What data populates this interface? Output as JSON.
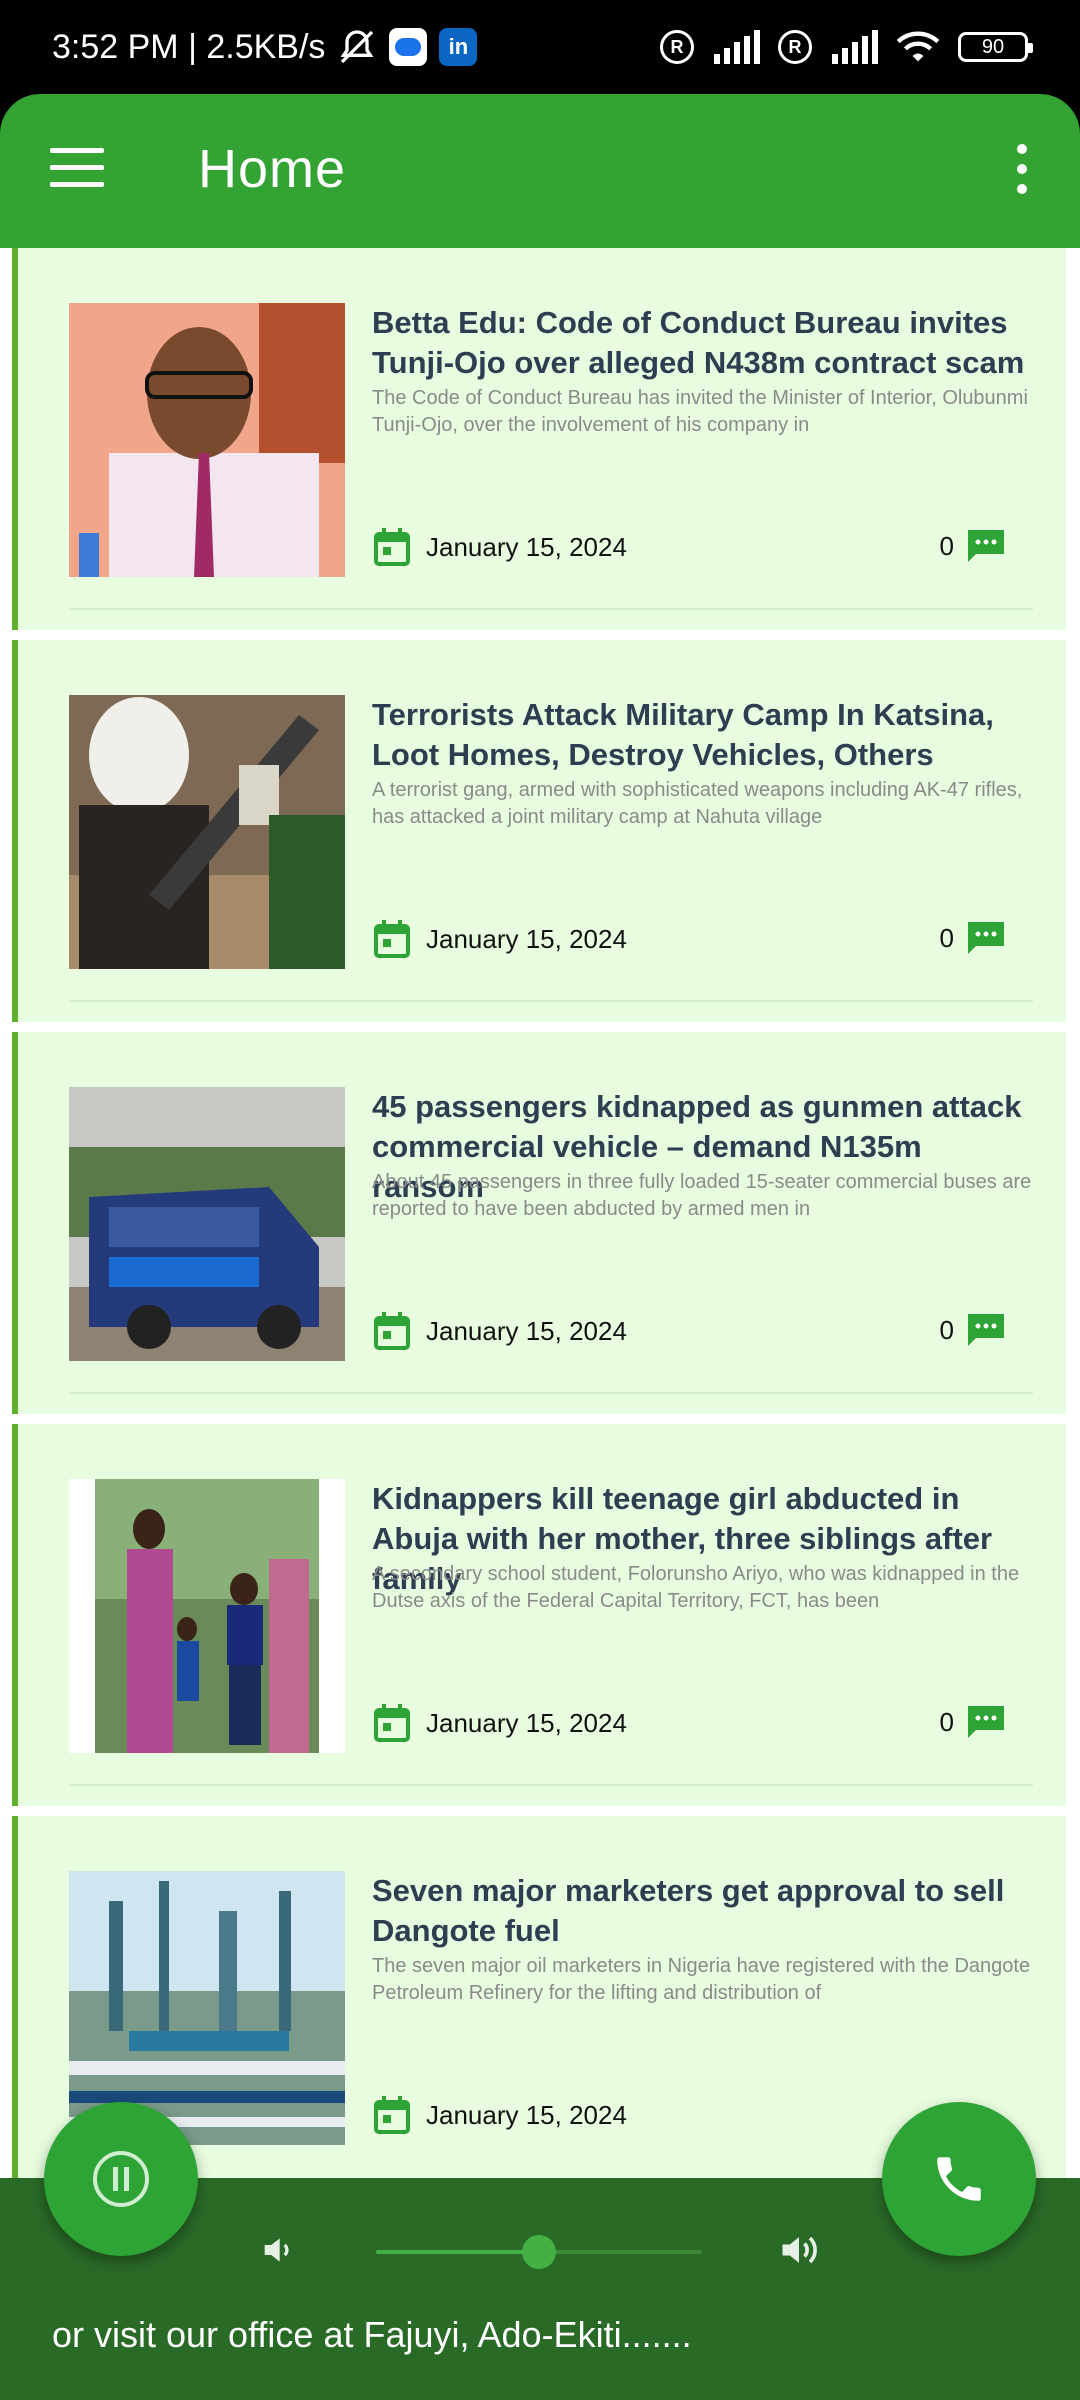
{
  "status_bar": {
    "time_speed": "3:52 PM | 2.5KB/s",
    "battery": "90"
  },
  "app_bar": {
    "title": "Home"
  },
  "articles": [
    {
      "title": "Betta Edu: Code of Conduct Bureau invites Tunji-Ojo over alleged N438m contract scam",
      "excerpt": "The Code of Conduct Bureau has invited the Minister of Interior, Olubunmi Tunji-Ojo, over the involvement of his company in",
      "date": "January 15, 2024",
      "comments": "0"
    },
    {
      "title": "Terrorists Attack Military Camp In Katsina, Loot Homes, Destroy Vehicles, Others",
      "excerpt": "A terrorist gang, armed with sophisticated weapons including AK-47 rifles, has attacked a joint military camp at Nahuta village",
      "date": "January 15, 2024",
      "comments": "0"
    },
    {
      "title": "45 passengers kidnapped as gunmen attack commercial vehicle – demand N135m ransom",
      "excerpt": "About 45 passengers in three fully loaded 15-seater commercial buses are reported to have been abducted by armed men in",
      "date": "January 15, 2024",
      "comments": "0"
    },
    {
      "title": "Kidnappers kill teenage girl abducted in Abuja with her mother, three siblings after family",
      "excerpt": "A secondary school student, Folorunsho Ariyo, who was kidnapped in the Dutse axis of the Federal Capital Territory, FCT, has been",
      "date": "January 15, 2024",
      "comments": "0"
    },
    {
      "title": "Seven major marketers get approval to sell Dangote fuel",
      "excerpt": "The seven major oil marketers in Nigeria have registered with the Dangote Petroleum Refinery for the lifting and distribution of",
      "date": "January 15, 2024",
      "comments": ""
    }
  ],
  "player": {
    "ticker": "or visit our office at Fajuyi, Ado-Ekiti.......",
    "volume": 0.5
  },
  "colors": {
    "primary": "#33a333",
    "card_bg": "#e8fde0",
    "player_bg": "#2a6a27"
  }
}
